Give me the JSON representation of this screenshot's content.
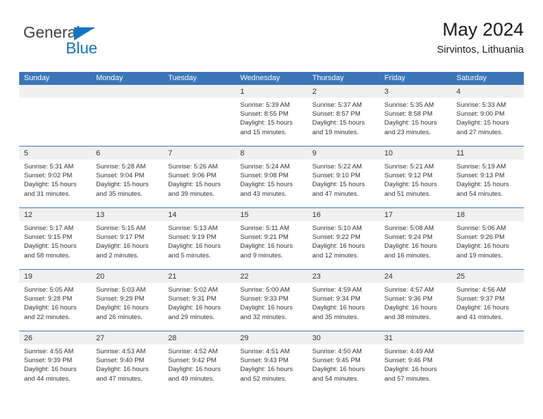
{
  "logo": {
    "word_top": "General",
    "word_bottom": "Blue",
    "triangle_color": "#1275c4",
    "top_color": "#3f3f3f"
  },
  "header": {
    "title": "May 2024",
    "subtitle": "Sirvintos, Lithuania"
  },
  "colors": {
    "header_blue": "#3a76b8",
    "daynum_band": "#f0f0f0",
    "text": "#333333"
  },
  "calendar": {
    "weekday_headers": [
      "Sunday",
      "Monday",
      "Tuesday",
      "Wednesday",
      "Thursday",
      "Friday",
      "Saturday"
    ],
    "weeks": [
      [
        {
          "day": "",
          "lines": []
        },
        {
          "day": "",
          "lines": []
        },
        {
          "day": "",
          "lines": []
        },
        {
          "day": "1",
          "lines": [
            "Sunrise: 5:39 AM",
            "Sunset: 8:55 PM",
            "Daylight: 15 hours",
            "and 15 minutes."
          ]
        },
        {
          "day": "2",
          "lines": [
            "Sunrise: 5:37 AM",
            "Sunset: 8:57 PM",
            "Daylight: 15 hours",
            "and 19 minutes."
          ]
        },
        {
          "day": "3",
          "lines": [
            "Sunrise: 5:35 AM",
            "Sunset: 8:58 PM",
            "Daylight: 15 hours",
            "and 23 minutes."
          ]
        },
        {
          "day": "4",
          "lines": [
            "Sunrise: 5:33 AM",
            "Sunset: 9:00 PM",
            "Daylight: 15 hours",
            "and 27 minutes."
          ]
        }
      ],
      [
        {
          "day": "5",
          "lines": [
            "Sunrise: 5:31 AM",
            "Sunset: 9:02 PM",
            "Daylight: 15 hours",
            "and 31 minutes."
          ]
        },
        {
          "day": "6",
          "lines": [
            "Sunrise: 5:28 AM",
            "Sunset: 9:04 PM",
            "Daylight: 15 hours",
            "and 35 minutes."
          ]
        },
        {
          "day": "7",
          "lines": [
            "Sunrise: 5:26 AM",
            "Sunset: 9:06 PM",
            "Daylight: 15 hours",
            "and 39 minutes."
          ]
        },
        {
          "day": "8",
          "lines": [
            "Sunrise: 5:24 AM",
            "Sunset: 9:08 PM",
            "Daylight: 15 hours",
            "and 43 minutes."
          ]
        },
        {
          "day": "9",
          "lines": [
            "Sunrise: 5:22 AM",
            "Sunset: 9:10 PM",
            "Daylight: 15 hours",
            "and 47 minutes."
          ]
        },
        {
          "day": "10",
          "lines": [
            "Sunrise: 5:21 AM",
            "Sunset: 9:12 PM",
            "Daylight: 15 hours",
            "and 51 minutes."
          ]
        },
        {
          "day": "11",
          "lines": [
            "Sunrise: 5:19 AM",
            "Sunset: 9:13 PM",
            "Daylight: 15 hours",
            "and 54 minutes."
          ]
        }
      ],
      [
        {
          "day": "12",
          "lines": [
            "Sunrise: 5:17 AM",
            "Sunset: 9:15 PM",
            "Daylight: 15 hours",
            "and 58 minutes."
          ]
        },
        {
          "day": "13",
          "lines": [
            "Sunrise: 5:15 AM",
            "Sunset: 9:17 PM",
            "Daylight: 16 hours",
            "and 2 minutes."
          ]
        },
        {
          "day": "14",
          "lines": [
            "Sunrise: 5:13 AM",
            "Sunset: 9:19 PM",
            "Daylight: 16 hours",
            "and 5 minutes."
          ]
        },
        {
          "day": "15",
          "lines": [
            "Sunrise: 5:11 AM",
            "Sunset: 9:21 PM",
            "Daylight: 16 hours",
            "and 9 minutes."
          ]
        },
        {
          "day": "16",
          "lines": [
            "Sunrise: 5:10 AM",
            "Sunset: 9:22 PM",
            "Daylight: 16 hours",
            "and 12 minutes."
          ]
        },
        {
          "day": "17",
          "lines": [
            "Sunrise: 5:08 AM",
            "Sunset: 9:24 PM",
            "Daylight: 16 hours",
            "and 16 minutes."
          ]
        },
        {
          "day": "18",
          "lines": [
            "Sunrise: 5:06 AM",
            "Sunset: 9:26 PM",
            "Daylight: 16 hours",
            "and 19 minutes."
          ]
        }
      ],
      [
        {
          "day": "19",
          "lines": [
            "Sunrise: 5:05 AM",
            "Sunset: 9:28 PM",
            "Daylight: 16 hours",
            "and 22 minutes."
          ]
        },
        {
          "day": "20",
          "lines": [
            "Sunrise: 5:03 AM",
            "Sunset: 9:29 PM",
            "Daylight: 16 hours",
            "and 26 minutes."
          ]
        },
        {
          "day": "21",
          "lines": [
            "Sunrise: 5:02 AM",
            "Sunset: 9:31 PM",
            "Daylight: 16 hours",
            "and 29 minutes."
          ]
        },
        {
          "day": "22",
          "lines": [
            "Sunrise: 5:00 AM",
            "Sunset: 9:33 PM",
            "Daylight: 16 hours",
            "and 32 minutes."
          ]
        },
        {
          "day": "23",
          "lines": [
            "Sunrise: 4:59 AM",
            "Sunset: 9:34 PM",
            "Daylight: 16 hours",
            "and 35 minutes."
          ]
        },
        {
          "day": "24",
          "lines": [
            "Sunrise: 4:57 AM",
            "Sunset: 9:36 PM",
            "Daylight: 16 hours",
            "and 38 minutes."
          ]
        },
        {
          "day": "25",
          "lines": [
            "Sunrise: 4:56 AM",
            "Sunset: 9:37 PM",
            "Daylight: 16 hours",
            "and 41 minutes."
          ]
        }
      ],
      [
        {
          "day": "26",
          "lines": [
            "Sunrise: 4:55 AM",
            "Sunset: 9:39 PM",
            "Daylight: 16 hours",
            "and 44 minutes."
          ]
        },
        {
          "day": "27",
          "lines": [
            "Sunrise: 4:53 AM",
            "Sunset: 9:40 PM",
            "Daylight: 16 hours",
            "and 47 minutes."
          ]
        },
        {
          "day": "28",
          "lines": [
            "Sunrise: 4:52 AM",
            "Sunset: 9:42 PM",
            "Daylight: 16 hours",
            "and 49 minutes."
          ]
        },
        {
          "day": "29",
          "lines": [
            "Sunrise: 4:51 AM",
            "Sunset: 9:43 PM",
            "Daylight: 16 hours",
            "and 52 minutes."
          ]
        },
        {
          "day": "30",
          "lines": [
            "Sunrise: 4:50 AM",
            "Sunset: 9:45 PM",
            "Daylight: 16 hours",
            "and 54 minutes."
          ]
        },
        {
          "day": "31",
          "lines": [
            "Sunrise: 4:49 AM",
            "Sunset: 9:46 PM",
            "Daylight: 16 hours",
            "and 57 minutes."
          ]
        },
        {
          "day": "",
          "lines": []
        }
      ]
    ]
  }
}
